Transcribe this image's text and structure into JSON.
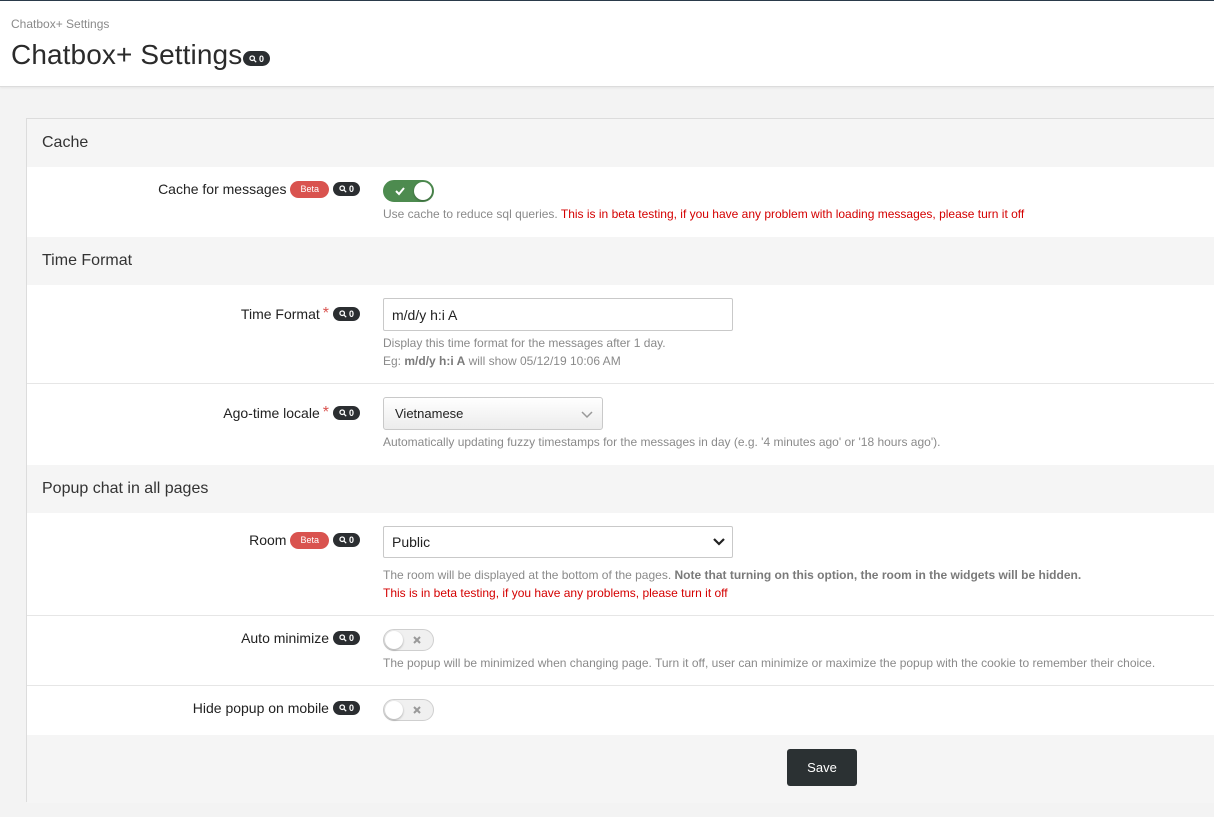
{
  "header": {
    "breadcrumb": "Chatbox+ Settings",
    "title": "Chatbox+ Settings",
    "title_badge_count": "0"
  },
  "sections": {
    "cache": {
      "title": "Cache",
      "cache_messages": {
        "label": "Cache for messages",
        "beta": "Beta",
        "count": "0",
        "enabled": true,
        "help": "Use cache to reduce sql queries.",
        "help_red": "This is in beta testing, if you have any problem with loading messages, please turn it off"
      }
    },
    "time_format": {
      "title": "Time Format",
      "time_format": {
        "label": "Time Format",
        "required": "*",
        "count": "0",
        "value": "m/d/y h:i A",
        "help_line1": "Display this time format for the messages after 1 day.",
        "help_eg": "Eg:",
        "help_eg_format": "m/d/y h:i A",
        "help_eg_result": "will show 05/12/19 10:06 AM"
      },
      "ago_locale": {
        "label": "Ago-time locale",
        "required": "*",
        "count": "0",
        "selected": "Vietnamese",
        "help": "Automatically updating fuzzy timestamps for the messages in day (e.g. '4 minutes ago' or '18 hours ago')."
      }
    },
    "popup": {
      "title": "Popup chat in all pages",
      "room": {
        "label": "Room",
        "beta": "Beta",
        "count": "0",
        "selected": "Public",
        "help": "The room will be displayed at the bottom of the pages.",
        "help_bold": "Note that turning on this option, the room in the widgets will be hidden.",
        "help_red": "This is in beta testing, if you have any problems, please turn it off"
      },
      "auto_minimize": {
        "label": "Auto minimize",
        "count": "0",
        "enabled": false,
        "help": "The popup will be minimized when changing page. Turn it off, user can minimize or maximize the popup with the cookie to remember their choice."
      },
      "hide_mobile": {
        "label": "Hide popup on mobile",
        "count": "0",
        "enabled": false
      }
    }
  },
  "actions": {
    "save_label": "Save"
  },
  "colors": {
    "toggle_on": "#4d8b4f",
    "beta": "#d9534f",
    "badge": "#2b2e31",
    "warning_text": "#d40000",
    "save_button": "#2b3133"
  },
  "icons": {
    "badge": "search-icon",
    "toggle_on": "check-icon",
    "toggle_off": "x-icon",
    "select": "chevron-down-icon"
  }
}
